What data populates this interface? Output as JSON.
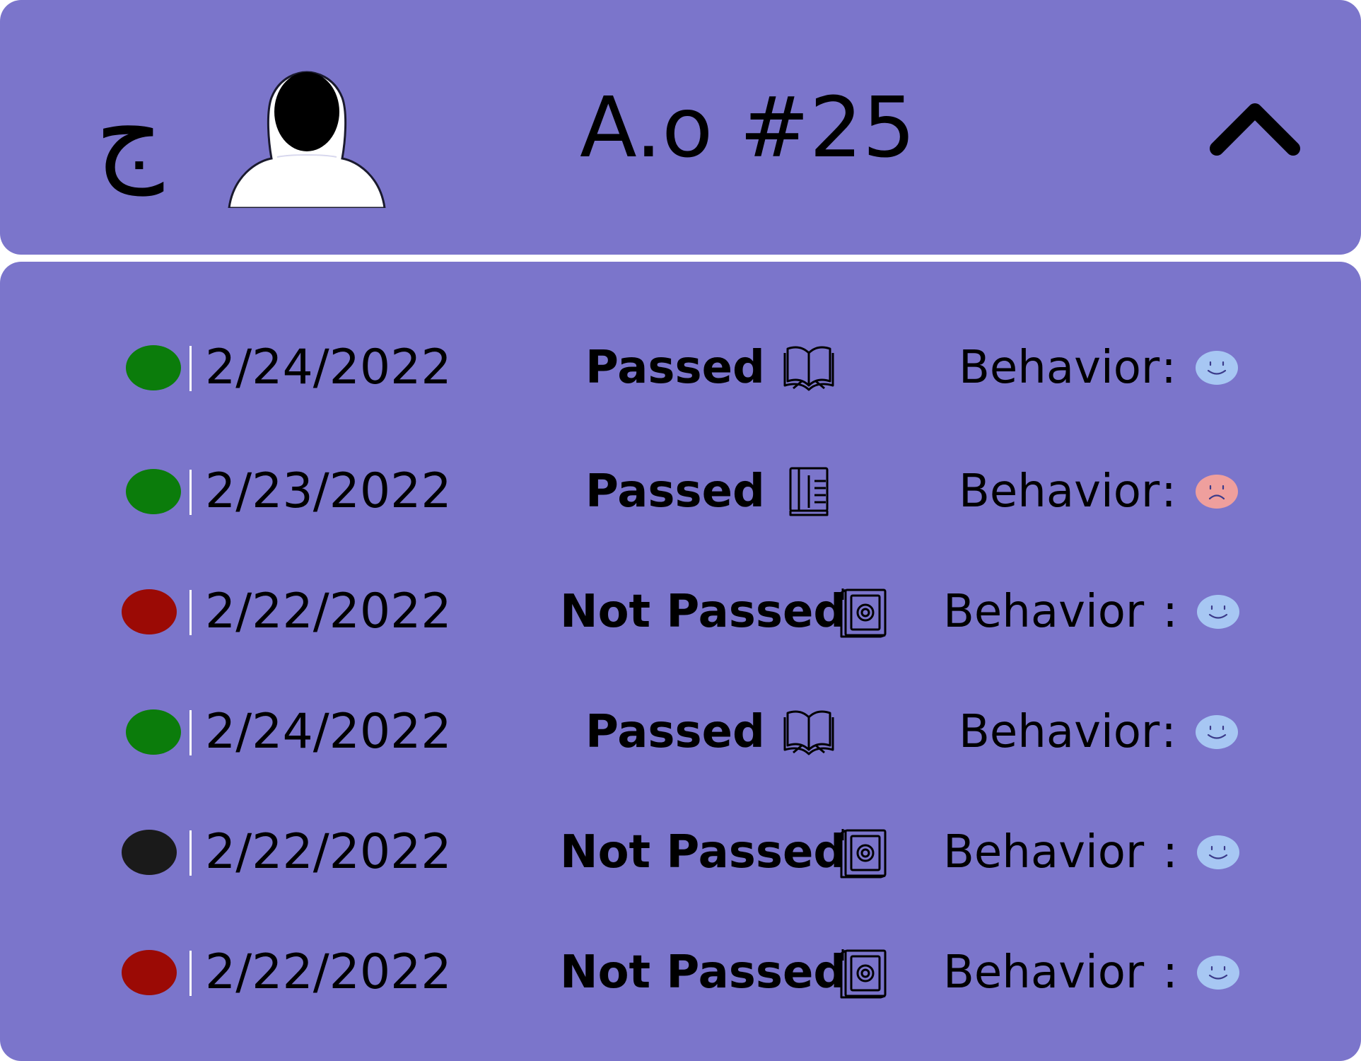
{
  "header": {
    "letter": "ج",
    "title": "A.o #25",
    "avatar_icon": "hijab-avatar-icon",
    "toggle_icon": "chevron-up-icon"
  },
  "colors": {
    "card_background": "#7b75cb",
    "passed": "#0b7c0b",
    "failed": "#9b0a05",
    "absent": "#1a1a1a",
    "happy_face": "#a7c7f3",
    "sad_face": "#ef9f9d"
  },
  "records": [
    {
      "date": "2/24/2022",
      "status": "Passed",
      "dot": "green",
      "book_icon": "open-book-icon",
      "behavior_label": "Behavior",
      "behavior_separator": ":",
      "mood": "happy"
    },
    {
      "date": "2/23/2022",
      "status": "Passed",
      "dot": "green",
      "book_icon": "closed-book-icon",
      "behavior_label": "Behavior",
      "behavior_separator": ":",
      "mood": "sad"
    },
    {
      "date": "2/22/2022",
      "status": "Not Passed",
      "dot": "red",
      "book_icon": "quran-book-icon",
      "behavior_label": "Behavior",
      "behavior_separator": ":",
      "mood": "happy"
    },
    {
      "date": "2/24/2022",
      "status": "Passed",
      "dot": "green",
      "book_icon": "open-book-icon",
      "behavior_label": "Behavior",
      "behavior_separator": ":",
      "mood": "happy"
    },
    {
      "date": "2/22/2022",
      "status": "Not Passed",
      "dot": "black",
      "book_icon": "quran-book-icon",
      "behavior_label": "Behavior",
      "behavior_separator": ":",
      "mood": "happy"
    },
    {
      "date": "2/22/2022",
      "status": "Not Passed",
      "dot": "red",
      "book_icon": "quran-book-icon",
      "behavior_label": "Behavior",
      "behavior_separator": ":",
      "mood": "happy"
    }
  ]
}
